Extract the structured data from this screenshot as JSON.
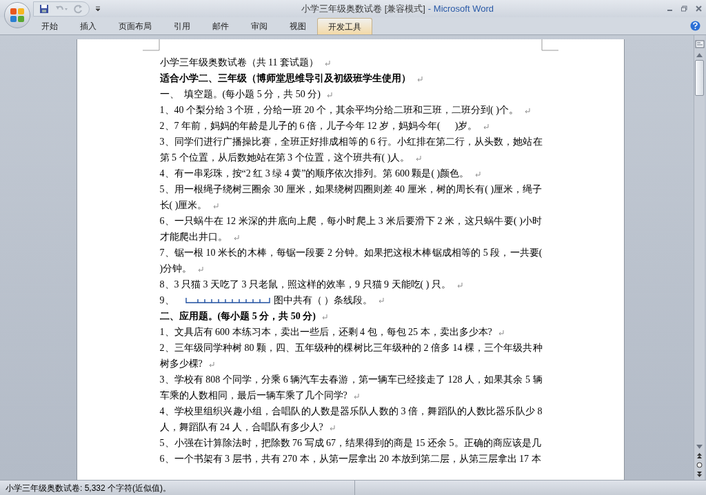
{
  "window": {
    "document_title": "小学三年级奥数试卷 [兼容模式]",
    "app_title": "- Microsoft Word"
  },
  "tabs": [
    {
      "label": "开始",
      "selected": false
    },
    {
      "label": "插入",
      "selected": false
    },
    {
      "label": "页面布局",
      "selected": false
    },
    {
      "label": "引用",
      "selected": false
    },
    {
      "label": "邮件",
      "selected": false
    },
    {
      "label": "审阅",
      "selected": false
    },
    {
      "label": "视图",
      "selected": false
    },
    {
      "label": "开发工具",
      "selected": true
    }
  ],
  "document": {
    "paragraphs": [
      {
        "kind": "text",
        "bold": false,
        "text": "小学三年级奥数试卷（共 11 套试题）"
      },
      {
        "kind": "text",
        "bold": true,
        "text": "适合小学二、三年级（博师堂思维导引及初级班学生使用）"
      },
      {
        "kind": "text",
        "bold": false,
        "text": "一、  填空题。(每小题 5 分，共 50 分)"
      },
      {
        "kind": "text",
        "bold": false,
        "text": "1、40 个梨分给 3 个班，分给一班 20 个，其余平均分给二班和三班，二班分到( )个。"
      },
      {
        "kind": "text",
        "bold": false,
        "text": "2、7 年前，妈妈的年龄是儿子的 6 倍，儿子今年 12 岁，妈妈今年(      )岁。"
      },
      {
        "kind": "text",
        "bold": false,
        "text": "3、同学们进行广播操比赛，全班正好排成相等的 6 行。小红排在第二行，从头数，她站在第 5 个位置，从后数她站在第 3 个位置，这个班共有( )人。"
      },
      {
        "kind": "text",
        "bold": false,
        "text": "4、有一串彩珠，按“2 红 3 绿 4 黄”的顺序依次排列。第 600 颗是( )颜色。"
      },
      {
        "kind": "text",
        "bold": false,
        "text": "5、用一根绳子绕树三圈余 30 厘米，如果绕树四圈则差 40 厘米，树的周长有( )厘米，绳子长( )厘米。"
      },
      {
        "kind": "text",
        "bold": false,
        "text": "6、一只蜗牛在 12 米深的井底向上爬，每小时爬上 3 米后要滑下 2 米，这只蜗牛要( )小时才能爬出井口。"
      },
      {
        "kind": "text",
        "bold": false,
        "text": "7、锯一根 10 米长的木棒，每锯一段要 2 分钟。如果把这根木棒锯成相等的 5 段，一共要( )分钟。"
      },
      {
        "kind": "text",
        "bold": false,
        "text": "8、3 只猫 3 天吃了 3 只老鼠，照这样的效率，9 只猫 9 天能吃( ) 只。"
      },
      {
        "kind": "segment_figure",
        "bold": false,
        "number": "9、",
        "text": "图中共有（ ）条线段。"
      },
      {
        "kind": "text",
        "bold": true,
        "text": "二、应用题。(每小题 5 分，共 50 分)"
      },
      {
        "kind": "text",
        "bold": false,
        "text": "1、文具店有 600 本练习本，卖出一些后，还剩 4 包，每包 25 本，卖出多少本?"
      },
      {
        "kind": "text",
        "bold": false,
        "text": "2、三年级同学种树 80 颗，四、五年级种的棵树比三年级种的 2 倍多 14 棵，三个年级共种树多少棵?"
      },
      {
        "kind": "text",
        "bold": false,
        "text": "3、学校有 808 个同学，分乘 6 辆汽车去春游，第一辆车已经接走了 128 人，如果其余 5 辆车乘的人数相同，最后一辆车乘了几个同学?"
      },
      {
        "kind": "text",
        "bold": false,
        "text": "4、学校里组织兴趣小组，合唱队的人数是器乐队人数的 3 倍，舞蹈队的人数比器乐队少 8 人，舞蹈队有 24 人，合唱队有多少人?"
      },
      {
        "kind": "text_cut",
        "bold": false,
        "text": "5、小强在计算除法时，把除数 76 写成 67，结果得到的商是 15 还余 5。正确的商应该是几"
      },
      {
        "kind": "text_cut",
        "bold": false,
        "text": "6、一个书架有 3 层书，共有 270 本，从第一层拿出 20 本放到第二层，从第三层拿出 17 本"
      }
    ]
  },
  "status_bar": {
    "text": "小学三年级奥数试卷: 5,332 个字符(近似值)。"
  }
}
